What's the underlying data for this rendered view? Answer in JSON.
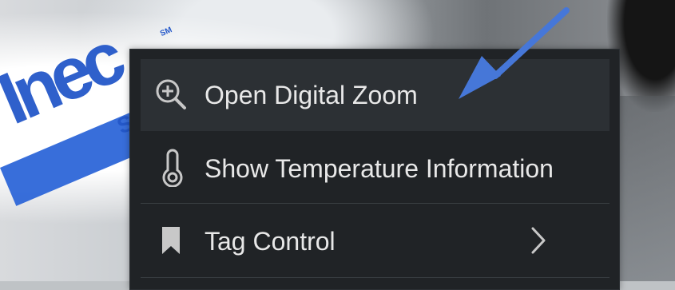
{
  "background": {
    "logo_large_text": "Inec",
    "logo_small_text": "SC",
    "logo_mark": "SM"
  },
  "menu": {
    "items": [
      {
        "label": "Open Digital Zoom",
        "icon": "zoom-in-icon",
        "active": true
      },
      {
        "label": "Show Temperature Information",
        "icon": "thermometer-icon",
        "active": false
      },
      {
        "label": "Tag Control",
        "icon": "bookmark-icon",
        "active": false,
        "submenu_icon": "chevron-right-icon"
      }
    ]
  },
  "annotation": {
    "arrow_color": "#4677d8",
    "arrow_icon": "pointer-arrow-icon"
  },
  "colors": {
    "menu_background": "#202326",
    "active_background": "#2c3034",
    "text": "#e8e8e8",
    "divider": "#3a3f43",
    "icon": "#c8c8c8",
    "logo_blue": "#2458c9"
  }
}
